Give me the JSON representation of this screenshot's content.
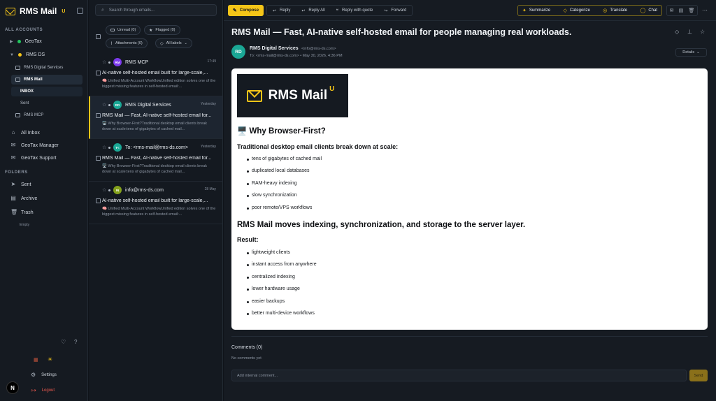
{
  "app": {
    "name": "RMS Mail",
    "badge": "U"
  },
  "sidebar": {
    "all_accounts_label": "ALL ACCOUNTS",
    "accounts": [
      {
        "label": "GeoTax",
        "color": "#22c55e",
        "expanded": false
      },
      {
        "label": "RMS DS",
        "color": "#f5c518",
        "expanded": true
      }
    ],
    "subaccounts": [
      {
        "label": "RMS Digital Services"
      },
      {
        "label": "RMS Mail"
      },
      {
        "label": "INBOX"
      },
      {
        "label": "Sent"
      },
      {
        "label": "RMS MCP"
      }
    ],
    "inboxes": [
      {
        "label": "All Inbox"
      },
      {
        "label": "GeoTax Manager"
      },
      {
        "label": "GeoTax Support"
      }
    ],
    "folders_label": "FOLDERS",
    "folders": [
      {
        "label": "Sent"
      },
      {
        "label": "Archive"
      },
      {
        "label": "Trash"
      }
    ],
    "empty_label": "Empty",
    "settings_label": "Settings",
    "logout_label": "Logout",
    "user_initial": "N"
  },
  "list": {
    "search_placeholder": "Search through emails...",
    "filters": {
      "unread": "Unread (0)",
      "flagged": "Flagged (0)",
      "attachments": "Attachments (0)",
      "labels": "All labels"
    },
    "emails": [
      {
        "initials": "RM",
        "avatar_color": "#7c3aed",
        "from": "RMS MCP",
        "date": "17:49",
        "subject": "AI-native self-hosted email built for large-scale,...",
        "preview": "🧠 Unified Multi-Account WorkflowUnified edition solves one of the biggest missing features in self-hosted email:..."
      },
      {
        "initials": "RD",
        "avatar_color": "#1aa795",
        "from": "RMS Digital Services",
        "date": "Yesterday",
        "subject": "RMS Mail — Fast, AI-native self-hosted email for...",
        "preview": "🖥️ Why Browser-First?Traditional desktop email clients break down at scale:tens of gigabytes of cached mail..."
      },
      {
        "initials": "T<",
        "avatar_color": "#1aa795",
        "from": "To: <rms-mail@rms-ds.com>",
        "date": "Yesterday",
        "subject": "RMS Mail — Fast, AI-native self-hosted email for...",
        "preview": "🖥️ Why Browser-First?Traditional desktop email clients break down at scale:tens of gigabytes of cached mail..."
      },
      {
        "initials": "IN",
        "avatar_color": "#84a11c",
        "from": "info@rms-ds.com",
        "date": "28 May",
        "subject": "AI-native self-hosted email built for large-scale,...",
        "preview": "🧠 Unified Multi-Account WorkflowUnified edition solves one of the biggest missing features in self-hosted email:..."
      }
    ]
  },
  "toolbar": {
    "compose": "Compose",
    "reply": "Reply",
    "reply_all": "Reply All",
    "reply_quote": "Reply with quote",
    "forward": "Forward",
    "summarize": "Summarize",
    "categorize": "Categorize",
    "translate": "Translate",
    "chat": "Chat"
  },
  "message": {
    "title": "RMS Mail — Fast, AI-native self-hosted email for people managing real workloads.",
    "sender_initials": "RD",
    "sender_name": "RMS Digital Services",
    "sender_email": "<info@rms-ds.com>",
    "to_line": "To: <rms-mail@rms-ds.com>  •  May 30, 2026, 4:36 PM",
    "details_label": "Details",
    "body": {
      "brand": "RMS Mail",
      "brand_badge": "U",
      "h_why": "🖥️ Why Browser-First?",
      "h_traditional": "Traditional desktop email clients break down at scale:",
      "problems": [
        "tens of gigabytes of cached mail",
        "duplicated local databases",
        "RAM-heavy indexing",
        "slow synchronization",
        "poor remote/VPS workflows"
      ],
      "h_moves": "RMS Mail moves indexing, synchronization, and storage to the server layer.",
      "h_result": "Result:",
      "results": [
        "lightweight clients",
        "instant access from anywhere",
        "centralized indexing",
        "lower hardware usage",
        "easier backups",
        "better multi-device workflows"
      ]
    }
  },
  "comments": {
    "title": "Comments (0)",
    "empty": "No comments yet",
    "placeholder": "Add internal comment...",
    "send": "Send"
  }
}
